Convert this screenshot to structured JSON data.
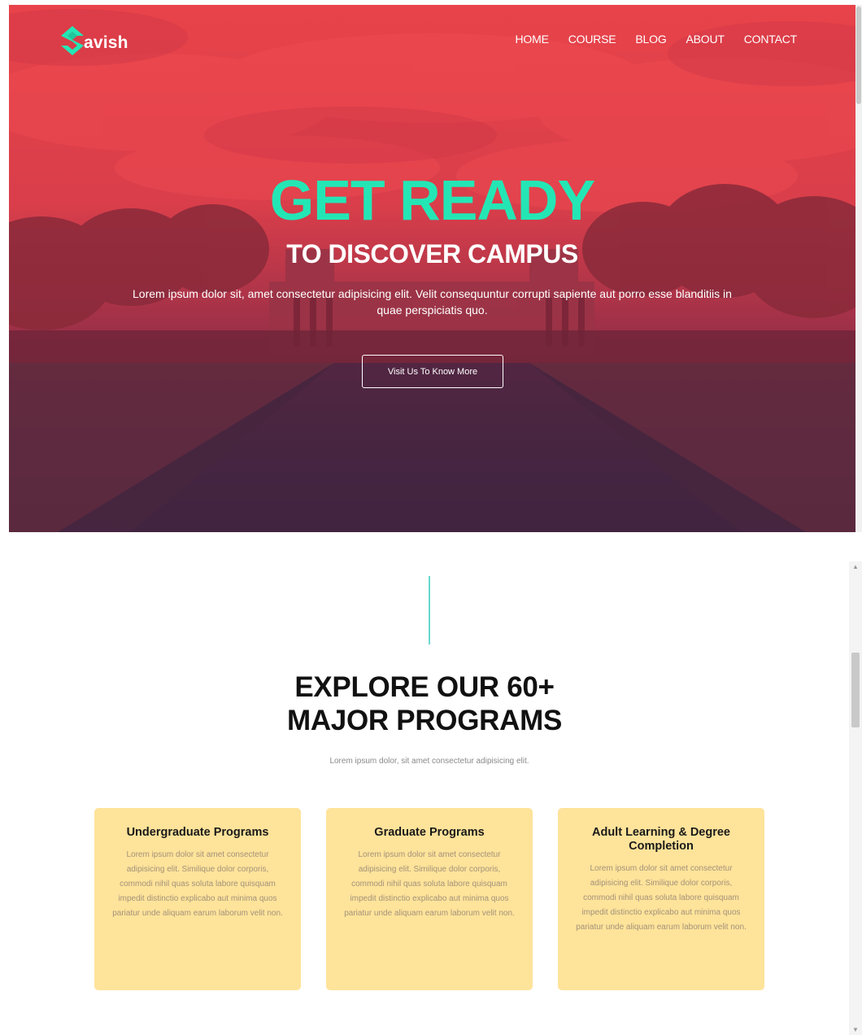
{
  "hero": {
    "logo_text": "avish",
    "nav": [
      "HOME",
      "COURSE",
      "BLOG",
      "ABOUT",
      "CONTACT"
    ],
    "title": "GET READY",
    "subtitle": "TO DISCOVER CAMPUS",
    "description": "Lorem ipsum dolor sit, amet consectetur adipisicing elit. Velit consequuntur corrupti sapiente aut porro esse blanditiis in quae perspiciatis quo.",
    "button_label": "Visit Us To Know More"
  },
  "programs": {
    "title_line1": "EXPLORE OUR 60+",
    "title_line2": "MAJOR PROGRAMS",
    "description": "Lorem ipsum dolor, sit amet consectetur adipisicing elit.",
    "cards": [
      {
        "title": "Undergraduate Programs",
        "text": "Lorem ipsum dolor sit amet consectetur adipisicing elit. Similique dolor corporis, commodi nihil quas soluta labore quisquam impedit distinctio explicabo aut minima quos pariatur unde aliquam earum laborum velit non."
      },
      {
        "title": "Graduate Programs",
        "text": "Lorem ipsum dolor sit amet consectetur adipisicing elit. Similique dolor corporis, commodi nihil quas soluta labore quisquam impedit distinctio explicabo aut minima quos pariatur unde aliquam earum laborum velit non."
      },
      {
        "title": "Adult Learning & Degree Completion",
        "text": "Lorem ipsum dolor sit amet consectetur adipisicing elit. Similique dolor corporis, commodi nihil quas soluta labore quisquam impedit distinctio explicabo aut minima quos pariatur unde aliquam earum laborum velit non."
      }
    ]
  },
  "colors": {
    "accent": "#24e6b5",
    "hero_top": "#e8434a",
    "hero_bottom": "#47263f",
    "card_bg": "#fee39a",
    "divider": "#69d8cf"
  },
  "icons": [
    "logo-s-icon",
    "scroll-up-arrow-icon",
    "scroll-down-arrow-icon"
  ]
}
